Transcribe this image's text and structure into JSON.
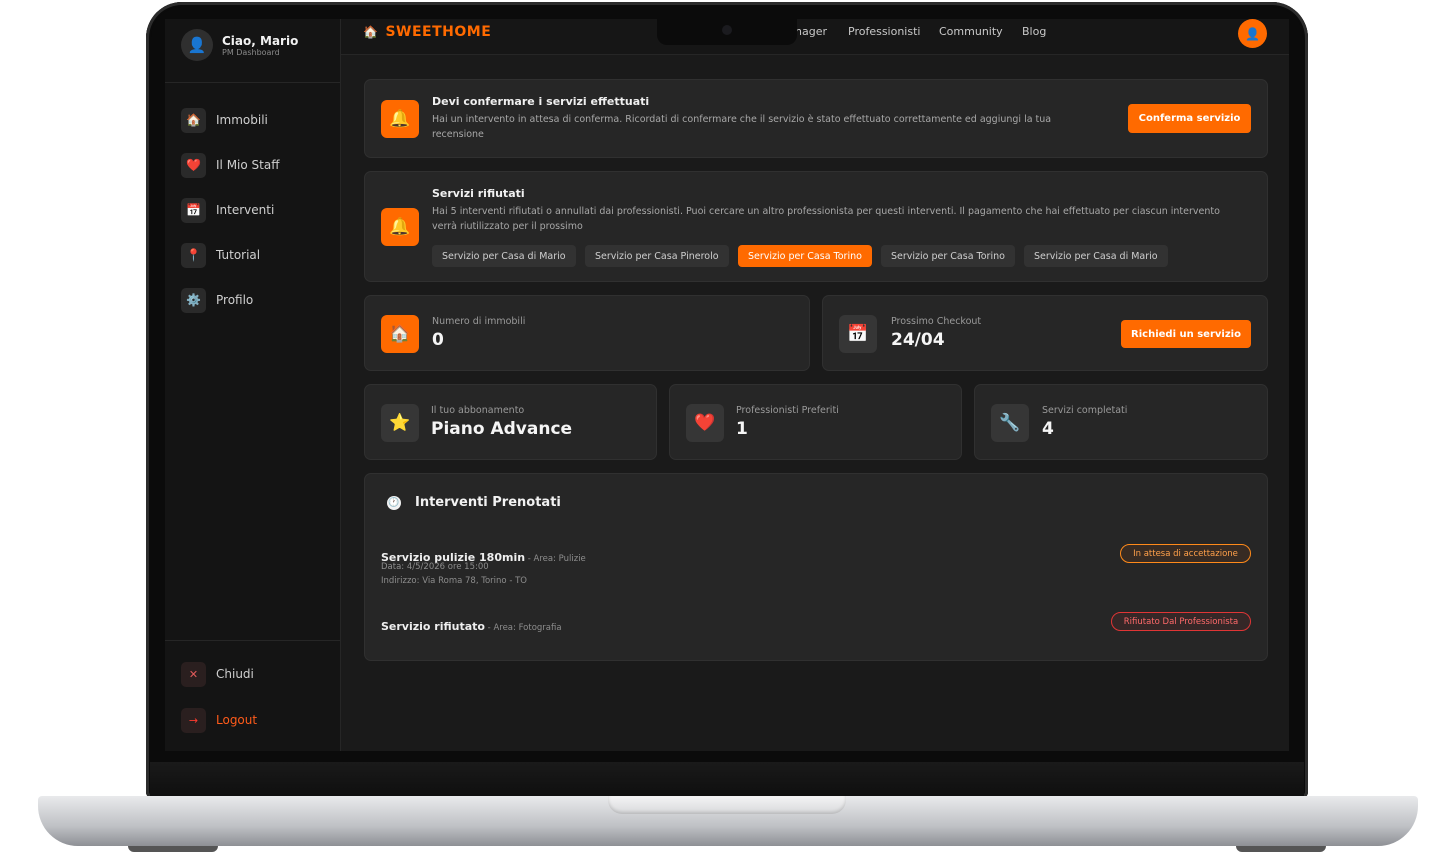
{
  "sidebar": {
    "user_name": "Ciao, Mario",
    "user_role": "PM Dashboard",
    "items": [
      {
        "label": "Immobili",
        "icon": "home-icon",
        "glyph": "🏠"
      },
      {
        "label": "Il Mio Staff",
        "icon": "heart-icon",
        "glyph": "❤️"
      },
      {
        "label": "Interventi",
        "icon": "calendar-icon",
        "glyph": "📅"
      },
      {
        "label": "Tutorial",
        "icon": "pin-icon",
        "glyph": "📍"
      },
      {
        "label": "Profilo",
        "icon": "gear-icon",
        "glyph": "⚙️"
      }
    ],
    "close_label": "Chiudi",
    "logout_label": "Logout"
  },
  "header": {
    "brand": "SWEETHOME",
    "menu": [
      "nager",
      "Professionisti",
      "Community",
      "Blog"
    ]
  },
  "confirm_card": {
    "title": "Devi confermare i servizi effettuati",
    "text": "Hai un intervento in attesa di conferma. Ricordati di confermare che il servizio è stato effettuato correttamente ed aggiungi la tua recensione",
    "button": "Conferma servizio"
  },
  "rejected_card": {
    "title": "Servizi rifiutati",
    "text": "Hai 5 interventi rifiutati o annullati dai professionisti. Puoi cercare un altro professionista per questi interventi. Il pagamento che hai effettuato per ciascun intervento verrà riutilizzato per il prossimo",
    "chips": [
      "Servizio per Casa di Mario",
      "Servizio per Casa Pinerolo",
      "Servizio per Casa Torino",
      "Servizio per Casa Torino",
      "Servizio per Casa di Mario"
    ],
    "active_chip_index": 2
  },
  "stats": {
    "properties_label": "Numero di immobili",
    "properties_value": "0",
    "checkout_label": "Prossimo Checkout",
    "checkout_value": "24/04",
    "request_button": "Richiedi un servizio",
    "subscription_label": "Il tuo abbonamento",
    "subscription_value": "Piano Advance",
    "favorites_label": "Professionisti Preferiti",
    "favorites_value": "1",
    "completed_label": "Servizi completati",
    "completed_value": "4"
  },
  "booked": {
    "title": "Interventi Prenotati",
    "rows": [
      {
        "title": "Servizio pulizie 180min",
        "area": " - Area: Pulizie",
        "date": "Data: 4/5/2026 ore 15:00",
        "address": "Indirizzo: Via Roma 78, Torino - TO",
        "status": "In attesa di accettazione"
      },
      {
        "title": "Servizio rifiutato",
        "area": " - Area: Fotografia",
        "status": "Rifiutato Dal Professionista"
      }
    ]
  },
  "colors": {
    "accent": "#ff6a00",
    "background": "#1a1a1a",
    "card": "#262626",
    "danger": "#e03535"
  }
}
